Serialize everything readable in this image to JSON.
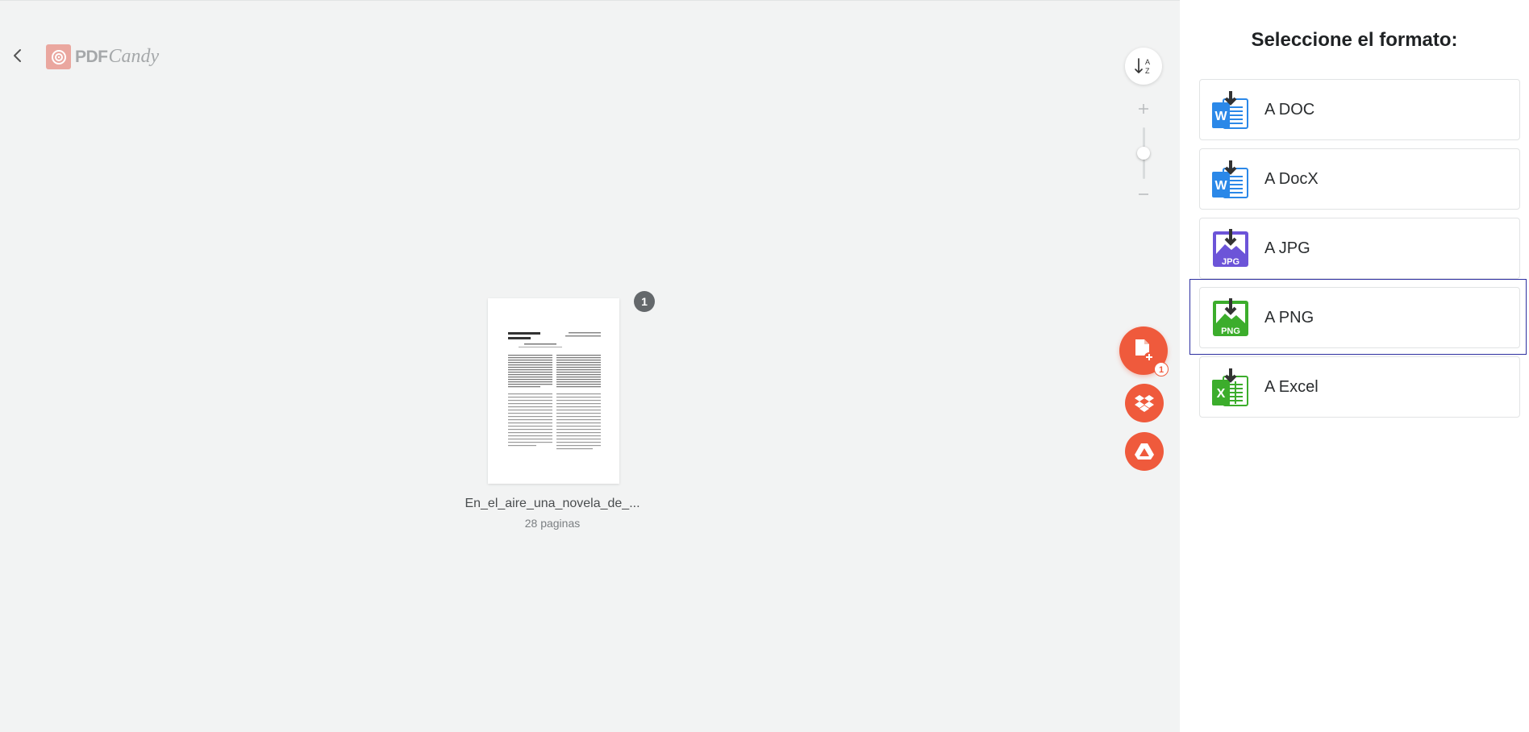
{
  "app": {
    "logo_pdf": "PDF",
    "logo_candy": "Candy"
  },
  "file": {
    "name": "En_el_aire_una_novela_de_...",
    "pages": "28 paginas",
    "page_badge": "1"
  },
  "tools": {
    "sort_label_top": "A",
    "sort_label_bottom": "Z",
    "add_file_count": "1"
  },
  "panel": {
    "title": "Seleccione el formato:",
    "formats": [
      {
        "label": "A DOC",
        "icon": "word-download-icon",
        "color": "#2b88e8"
      },
      {
        "label": "A DocX",
        "icon": "word-download-icon",
        "color": "#2b88e8"
      },
      {
        "label": "A JPG",
        "icon": "jpg-download-icon",
        "color": "#6c54d8",
        "tag": "JPG"
      },
      {
        "label": "A PNG",
        "icon": "png-download-icon",
        "color": "#3cad2c",
        "tag": "PNG",
        "selected": true
      },
      {
        "label": "A Excel",
        "icon": "excel-download-icon",
        "color": "#3cad2c"
      }
    ]
  },
  "colors": {
    "accent": "#ef5a3c",
    "selection": "#2d2fa0"
  }
}
